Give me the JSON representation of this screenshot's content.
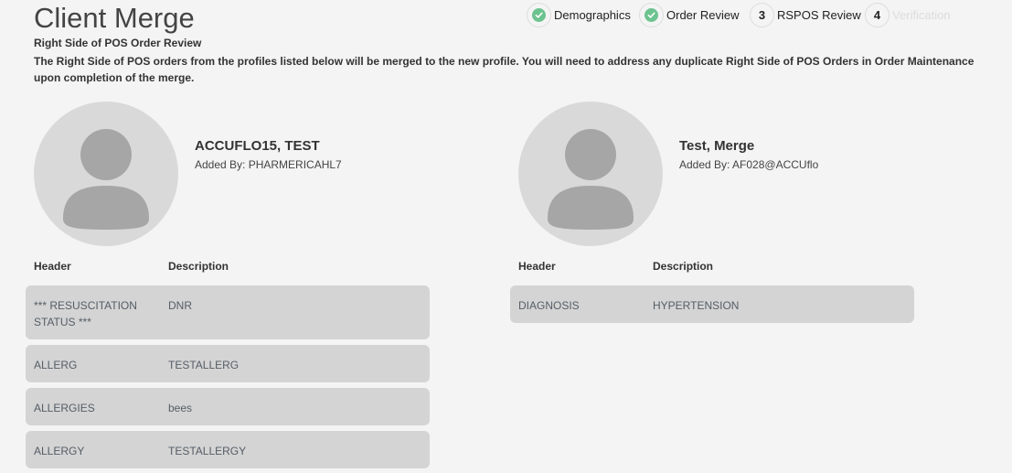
{
  "page": {
    "title": "Client Merge",
    "subtitle": "Right Side of POS Order Review",
    "description": "The Right Side of POS orders from the profiles listed below will be merged to the new profile. You will need to address any duplicate Right Side of POS Orders in Order Maintenance upon completion of the merge."
  },
  "stepper": {
    "steps": [
      {
        "marker": "",
        "label": "Demographics",
        "state": "complete"
      },
      {
        "marker": "",
        "label": "Order Review",
        "state": "complete"
      },
      {
        "marker": "3",
        "label": "RSPOS Review",
        "state": "current"
      },
      {
        "marker": "4",
        "label": "Verification",
        "state": "upcoming"
      }
    ]
  },
  "profiles": [
    {
      "name": "ACCUFLO15, TEST",
      "added_by": "Added By: PHARMERICAHL7",
      "header_col": "Header",
      "description_col": "Description",
      "rows": [
        {
          "header": "*** RESUSCITATION STATUS ***",
          "description": "DNR"
        },
        {
          "header": "ALLERG",
          "description": "TESTALLERG"
        },
        {
          "header": "ALLERGIES",
          "description": "bees"
        },
        {
          "header": "ALLERGY",
          "description": "TESTALLERGY"
        }
      ]
    },
    {
      "name": "Test, Merge",
      "added_by": "Added By: AF028@ACCUflo",
      "header_col": "Header",
      "description_col": "Description",
      "rows": [
        {
          "header": "DIAGNOSIS",
          "description": "HYPERTENSION"
        }
      ]
    }
  ],
  "colors": {
    "background": "#f4f4f4",
    "row_background": "#d4d4d4",
    "check_green": "#6cc38f",
    "avatar_bg": "#d9d9d9",
    "avatar_fg": "#a6a6a6"
  }
}
